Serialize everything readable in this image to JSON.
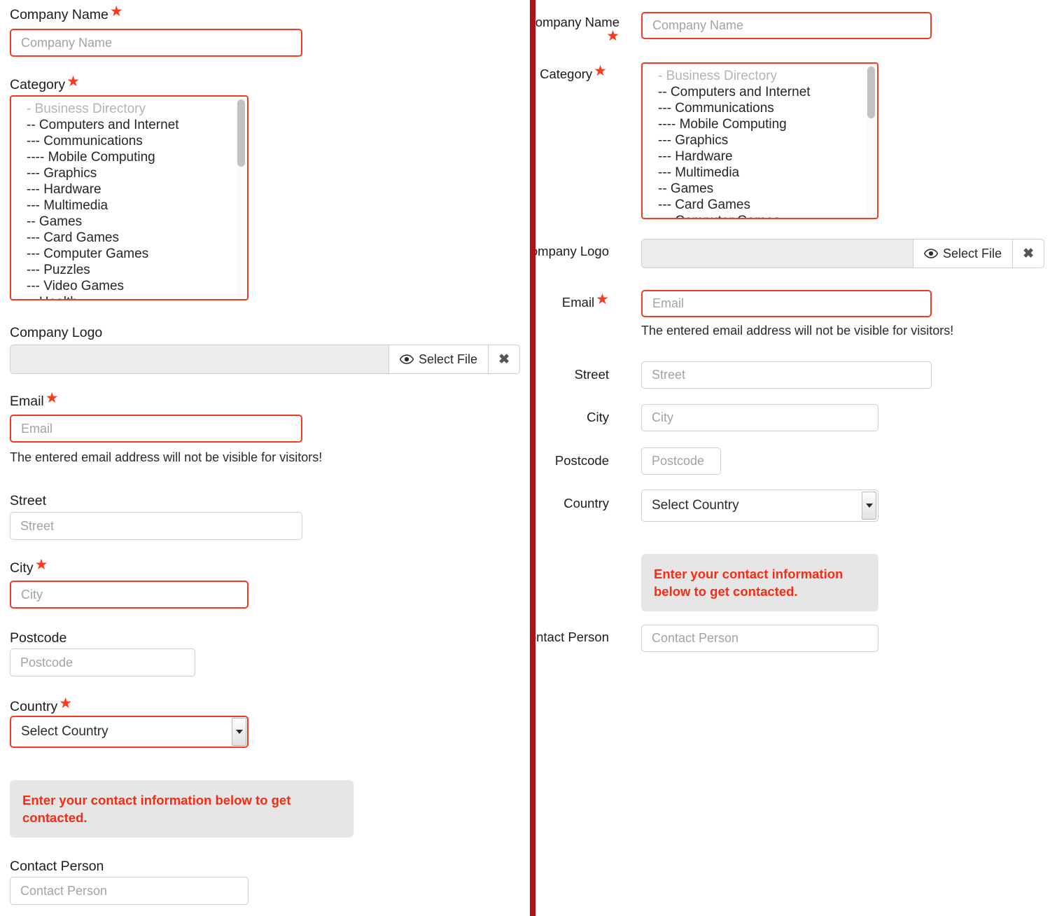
{
  "theme": {
    "required_red": "#f93a1c",
    "divider_red": "#b0121a",
    "alert_bg": "#e6e6e6",
    "alert_text": "#fb2a12",
    "border_gray": "#cfcfcf",
    "placeholder_gray": "#a3a3a3"
  },
  "categories": [
    {
      "label": "- Business Directory",
      "muted": true
    },
    {
      "label": "-- Computers and Internet",
      "muted": false
    },
    {
      "label": "--- Communications",
      "muted": false
    },
    {
      "label": "---- Mobile Computing",
      "muted": false
    },
    {
      "label": "--- Graphics",
      "muted": false
    },
    {
      "label": "--- Hardware",
      "muted": false
    },
    {
      "label": "--- Multimedia",
      "muted": false
    },
    {
      "label": "-- Games",
      "muted": false
    },
    {
      "label": "--- Card Games",
      "muted": false
    },
    {
      "label": "--- Computer Games",
      "muted": false
    },
    {
      "label": "--- Puzzles",
      "muted": false
    },
    {
      "label": "--- Video Games",
      "muted": false
    },
    {
      "label": "-- Health",
      "muted": false
    }
  ],
  "form": {
    "company_name": {
      "label": "Company Name",
      "placeholder": "Company Name",
      "value": "",
      "required": true
    },
    "category": {
      "label": "Category",
      "required": true
    },
    "company_logo": {
      "label": "Company Logo",
      "value": "",
      "required": false,
      "select_file_label": "Select File",
      "clear_label": "✖"
    },
    "email": {
      "label": "Email",
      "placeholder": "Email",
      "value": "",
      "required": true,
      "help": "The entered email address will not be visible for visitors!"
    },
    "street": {
      "label": "Street",
      "placeholder": "Street",
      "value": "",
      "required": false
    },
    "city": {
      "label": "City",
      "placeholder": "City",
      "value": "",
      "required": true
    },
    "postcode": {
      "label": "Postcode",
      "placeholder": "Postcode",
      "value": "",
      "required": false
    },
    "country": {
      "label": "Country",
      "selected": "Select Country",
      "required": true
    },
    "contact_person": {
      "label": "Contact Person",
      "placeholder": "Contact Person",
      "value": "",
      "required": false
    }
  },
  "alert": {
    "text": "Enter your contact information below to get contacted."
  },
  "right_panel": {
    "company_name_label": "Company Name",
    "category_label": "Category",
    "company_logo_label": "Company Logo",
    "email_label": "Email",
    "street_label": "Street",
    "city_label": "City",
    "postcode_label": "Postcode",
    "country_label": "Country",
    "contact_person_label": "Contact Person"
  }
}
